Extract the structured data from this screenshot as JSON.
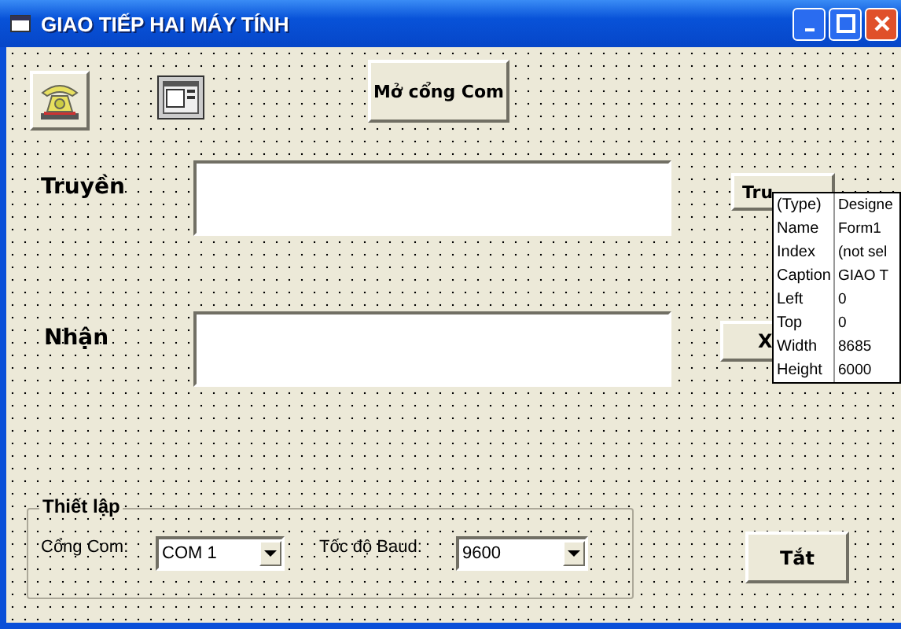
{
  "window": {
    "title": "GIAO TIẾP HAI MÁY TÍNH"
  },
  "open_button": {
    "label": "Mở cổng Com"
  },
  "send": {
    "label": "Truyền",
    "button": "Tru"
  },
  "receive": {
    "label": "Nhận",
    "button": "X"
  },
  "settings": {
    "title": "Thiết lập",
    "port_label": "Cổng Com:",
    "port_value": "COM 1",
    "baud_label": "Tốc độ Baud:",
    "baud_value": "9600"
  },
  "off_button": {
    "label": "Tắt"
  },
  "properties": [
    {
      "name": "(Type)",
      "value": "Designe"
    },
    {
      "name": "Name",
      "value": "Form1"
    },
    {
      "name": "Index",
      "value": "(not sel"
    },
    {
      "name": "Caption",
      "value": "GIAO T"
    },
    {
      "name": "Left",
      "value": "0"
    },
    {
      "name": "Top",
      "value": "0"
    },
    {
      "name": "Width",
      "value": "8685"
    },
    {
      "name": "Height",
      "value": "6000"
    }
  ]
}
